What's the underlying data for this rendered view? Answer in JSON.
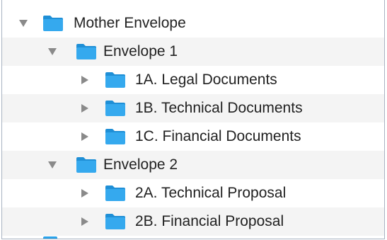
{
  "tree": {
    "items": [
      {
        "label": "Mother Envelope",
        "expanded": true,
        "level": 0,
        "icon": "folder-icon"
      },
      {
        "label": "Envelope 1",
        "expanded": true,
        "level": 1,
        "icon": "folder-icon"
      },
      {
        "label": "1A. Legal Documents",
        "expanded": false,
        "level": 2,
        "icon": "folder-icon"
      },
      {
        "label": "1B. Technical Documents",
        "expanded": false,
        "level": 2,
        "icon": "folder-icon"
      },
      {
        "label": "1C. Financial Documents",
        "expanded": false,
        "level": 2,
        "icon": "folder-icon"
      },
      {
        "label": "Envelope 2",
        "expanded": true,
        "level": 1,
        "icon": "folder-icon"
      },
      {
        "label": "2A. Technical Proposal",
        "expanded": false,
        "level": 2,
        "icon": "folder-icon"
      },
      {
        "label": "2B. Financial Proposal",
        "expanded": false,
        "level": 2,
        "icon": "folder-icon"
      }
    ]
  },
  "colors": {
    "folder_body": "#35a9ee",
    "folder_tab": "#1f8fd6",
    "disclosure": "#8a8a8a",
    "stripe": "#f4f4f4",
    "border": "#a9b3c2"
  }
}
